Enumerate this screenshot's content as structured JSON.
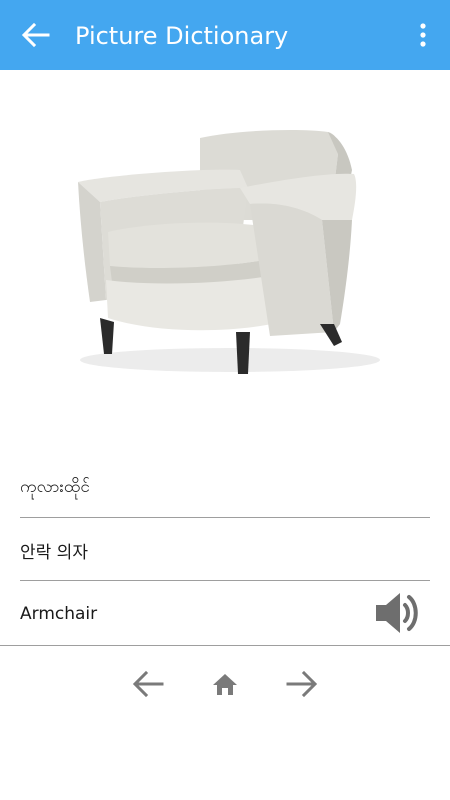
{
  "appbar": {
    "title": "Picture Dictionary",
    "back_icon": "arrow-left-icon",
    "menu_icon": "more-vert-icon",
    "color": "#44a7f0"
  },
  "entry": {
    "burmese": "ကုလားထိုင်",
    "korean": "안락 의자",
    "english": "Armchair",
    "speaker_icon": "volume-up-icon"
  },
  "bottom_nav": {
    "prev_icon": "arrow-left-icon",
    "home_icon": "home-icon",
    "next_icon": "arrow-right-icon",
    "icon_color": "#7a7a7a"
  }
}
